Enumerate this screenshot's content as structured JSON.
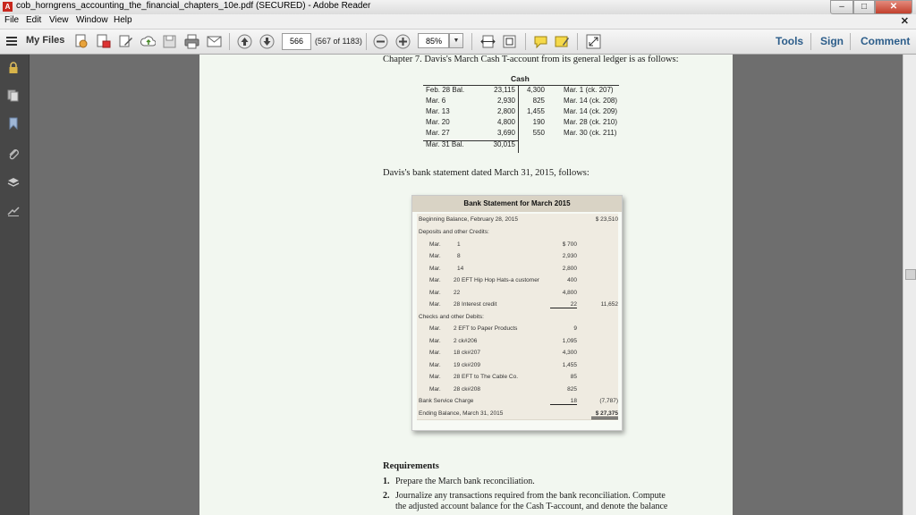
{
  "window": {
    "title": "cob_horngrens_accounting_the_financial_chapters_10e.pdf (SECURED) - Adobe Reader",
    "min_glyph": "–",
    "max_glyph": "□",
    "close_glyph": "✕"
  },
  "menu": {
    "items": [
      "File",
      "Edit",
      "View",
      "Window",
      "Help"
    ],
    "close_doc": "✕"
  },
  "toolbar": {
    "my_files": "My Files",
    "page_number": "566",
    "page_count": "(567 of 1183)",
    "zoom": "85%",
    "tools": "Tools",
    "sign": "Sign",
    "comment": "Comment"
  },
  "sidebar": {
    "icons": [
      "lock-icon",
      "pages-icon",
      "bookmark-icon",
      "attachment-icon",
      "layers-icon",
      "signatures-icon"
    ]
  },
  "document": {
    "intro": "Chapter 7. Davis's March Cash T-account from its general ledger is as follows:",
    "taccount": {
      "title": "Cash",
      "left": [
        {
          "label": "Feb. 28 Bal.",
          "amount": "23,115"
        },
        {
          "label": "Mar.  6",
          "amount": "2,930"
        },
        {
          "label": "Mar. 13",
          "amount": "2,800"
        },
        {
          "label": "Mar. 20",
          "amount": "4,800"
        },
        {
          "label": "Mar. 27",
          "amount": "3,690"
        },
        {
          "label": "Mar. 31 Bal.",
          "amount": "30,015"
        }
      ],
      "right": [
        {
          "amount": "4,300",
          "label": "Mar.  1   (ck. 207)"
        },
        {
          "amount": "825",
          "label": "Mar. 14 (ck. 208)"
        },
        {
          "amount": "1,455",
          "label": "Mar. 14 (ck. 209)"
        },
        {
          "amount": "190",
          "label": "Mar. 28 (ck. 210)"
        },
        {
          "amount": "550",
          "label": "Mar. 30 (ck. 211)"
        }
      ]
    },
    "bank_intro": "Davis's bank statement dated March 31, 2015, follows:",
    "bank_statement": {
      "title": "Bank Statement for March 2015",
      "rows": [
        {
          "c1": "Beginning Balance, February 28, 2015",
          "c2": "",
          "c3": "",
          "c4": "$ 23,510"
        },
        {
          "c1": "Deposits and other Credits:",
          "c2": "",
          "c3": "",
          "c4": ""
        },
        {
          "c1": "Mar.",
          "c2": "1",
          "c3": "$  700",
          "c4": ""
        },
        {
          "c1": "Mar.",
          "c2": "8",
          "c3": "2,930",
          "c4": ""
        },
        {
          "c1": "Mar.",
          "c2": "14",
          "c3": "2,800",
          "c4": ""
        },
        {
          "c1": "Mar.",
          "c2": "20 EFT Hip Hop Hats-a customer",
          "c3": "400",
          "c4": ""
        },
        {
          "c1": "Mar.",
          "c2": "22",
          "c3": "4,800",
          "c4": ""
        },
        {
          "c1": "Mar.",
          "c2": "28 Interest credit",
          "c3": "22",
          "c4": "11,652"
        },
        {
          "c1": "Checks and other Debits:",
          "c2": "",
          "c3": "",
          "c4": ""
        },
        {
          "c1": "Mar.",
          "c2": "  2 EFT to Paper Products",
          "c3": "9",
          "c4": ""
        },
        {
          "c1": "Mar.",
          "c2": "  2 ck#206",
          "c3": "1,095",
          "c4": ""
        },
        {
          "c1": "Mar.",
          "c2": "18 ck#207",
          "c3": "4,300",
          "c4": ""
        },
        {
          "c1": "Mar.",
          "c2": "19 ck#209",
          "c3": "1,455",
          "c4": ""
        },
        {
          "c1": "Mar.",
          "c2": "28 EFT to The Cable Co.",
          "c3": "85",
          "c4": ""
        },
        {
          "c1": "Mar.",
          "c2": "28 ck#208",
          "c3": "825",
          "c4": ""
        },
        {
          "c1": "Bank Service Charge",
          "c2": "",
          "c3": "18",
          "c4": "(7,787)"
        },
        {
          "c1": "Ending Balance, March 31, 2015",
          "c2": "",
          "c3": "",
          "c4": "$ 27,375"
        }
      ]
    },
    "requirements": {
      "heading": "Requirements",
      "items": [
        {
          "num": "1.",
          "text": "Prepare the March bank reconciliation."
        },
        {
          "num": "2.",
          "text": "Journalize any transactions required from the bank reconciliation. Compute"
        },
        {
          "num": "",
          "text": "the adjusted account balance for the Cash T-account, and denote the balance"
        }
      ]
    }
  }
}
